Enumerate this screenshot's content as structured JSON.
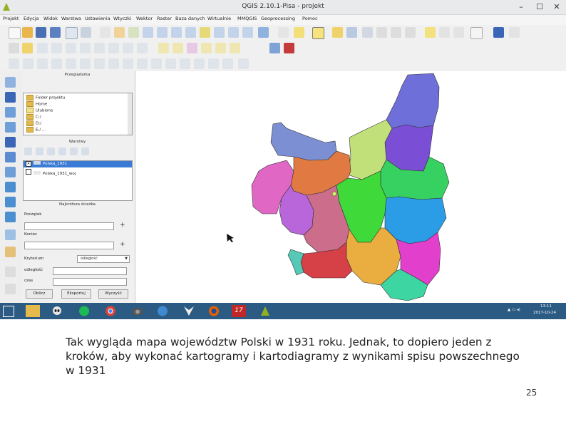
{
  "window": {
    "title": "QGIS 2.10.1-Pisa - projekt",
    "minimize": "–",
    "maximize": "☐",
    "close": "✕"
  },
  "menu": [
    "Projekt",
    "Edycja",
    "Widok",
    "Warstwa",
    "Ustawienia",
    "Wtyczki",
    "Wektor",
    "Raster",
    "Baza danych",
    "Wirtualnie",
    "MMQGIS",
    "Geoprocessing",
    "Pomoc"
  ],
  "panels": {
    "browser": {
      "title": "Przeglądarka",
      "items": [
        "Folder projektu",
        "Home",
        "Ulubione",
        "C:/",
        "D:/",
        "E:/ ..."
      ]
    },
    "layers": {
      "title": "Warstwy",
      "items": [
        {
          "label": "Polska_1931",
          "checked": true,
          "selected": true
        },
        {
          "label": "Polska_1931_woj",
          "checked": false,
          "selected": false
        }
      ]
    },
    "shortest_path": {
      "title": "Najkrótsza ścieżka",
      "start_label": "Początek",
      "end_label": "Koniec",
      "criterion_label": "Kryterium",
      "criterion_value": "odległość",
      "length_label": "odległość",
      "time_label": "czas",
      "calc_button": "Oblicz",
      "export_button": "Eksportuj",
      "clear_button": "Wyczyść",
      "pick_icon": "+"
    }
  },
  "taskbar": {
    "icons": [
      "file-explorer-icon",
      "alien-icon",
      "spotify-icon",
      "chrome-icon",
      "camera-icon",
      "globe-icon",
      "wolf-icon",
      "firefox-icon",
      "game-17-icon",
      "qgis-icon"
    ],
    "tray_time": "13:11",
    "tray_date": "2017-10-24"
  },
  "map": {
    "regions": [
      {
        "name": "northeast",
        "color": "#6e6fd8"
      },
      {
        "name": "east-upper",
        "color": "#7a4fd6"
      },
      {
        "name": "lime",
        "color": "#c2e07a"
      },
      {
        "name": "pomerania",
        "color": "#7b8fd2"
      },
      {
        "name": "central-west",
        "color": "#e067c4"
      },
      {
        "name": "orange",
        "color": "#e07a42"
      },
      {
        "name": "green-east",
        "color": "#37d161"
      },
      {
        "name": "green-center",
        "color": "#3fd93a"
      },
      {
        "name": "purple",
        "color": "#b866d9"
      },
      {
        "name": "mauve",
        "color": "#cc6d8b"
      },
      {
        "name": "blue",
        "color": "#2b9de6"
      },
      {
        "name": "gold",
        "color": "#e9ae3f"
      },
      {
        "name": "magenta",
        "color": "#e33fcd"
      },
      {
        "name": "red",
        "color": "#d64047"
      },
      {
        "name": "teal-south",
        "color": "#3dd6a2"
      },
      {
        "name": "teal-small",
        "color": "#55c8b6"
      }
    ]
  },
  "slide": {
    "caption": "Tak wygląda mapa województw Polski w 1931 roku. Jednak, to dopiero jeden z kroków, aby wykonać kartogramy i kartodiagramy z wynikami spisu powszechnego w 1931",
    "page_number": "25"
  }
}
